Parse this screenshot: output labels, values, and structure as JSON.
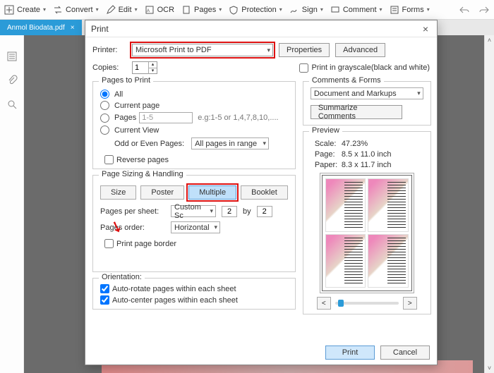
{
  "toolbar": {
    "items": [
      "Create",
      "Convert",
      "Edit",
      "OCR",
      "Pages",
      "Protection",
      "Sign",
      "Comment",
      "Forms"
    ]
  },
  "tab": {
    "filename": "Anmol Biodata.pdf"
  },
  "dialog": {
    "title": "Print",
    "printer_label": "Printer:",
    "printer_value": "Microsoft Print to PDF",
    "properties_btn": "Properties",
    "advanced_btn": "Advanced",
    "copies_label": "Copies:",
    "copies_value": "1",
    "grayscale_label": "Print in grayscale(black and white)",
    "ptp": {
      "legend": "Pages to Print",
      "all": "All",
      "current": "Current page",
      "pages": "Pages",
      "pages_value": "1-5",
      "pages_hint": "e.g:1-5 or 1,4,7,8,10,....",
      "view": "Current View",
      "oddlabel": "Odd or Even Pages:",
      "oddvalue": "All pages in range",
      "reverse": "Reverse pages"
    },
    "cf": {
      "legend": "Comments & Forms",
      "value": "Document and Markups",
      "summarize": "Summarize Comments"
    },
    "sizing": {
      "legend": "Page Sizing & Handling",
      "size": "Size",
      "poster": "Poster",
      "multiple": "Multiple",
      "booklet": "Booklet",
      "pps_label": "Pages per sheet:",
      "pps_mode": "Custom Sc",
      "pps_x": "2",
      "pps_by": "by",
      "pps_y": "2",
      "order_label": "Pages order:",
      "order_value": "Horizontal",
      "border": "Print page border"
    },
    "preview": {
      "legend": "Preview",
      "scale_k": "Scale:",
      "scale_v": "47.23%",
      "page_k": "Page:",
      "page_v": "8.5 x 11.0 inch",
      "paper_k": "Paper:",
      "paper_v": "8.3 x 11.7 inch"
    },
    "orientation": {
      "legend": "Orientation:",
      "autorotate": "Auto-rotate pages within each sheet",
      "autocenter": "Auto-center pages within each sheet"
    },
    "print_btn": "Print",
    "cancel_btn": "Cancel"
  }
}
